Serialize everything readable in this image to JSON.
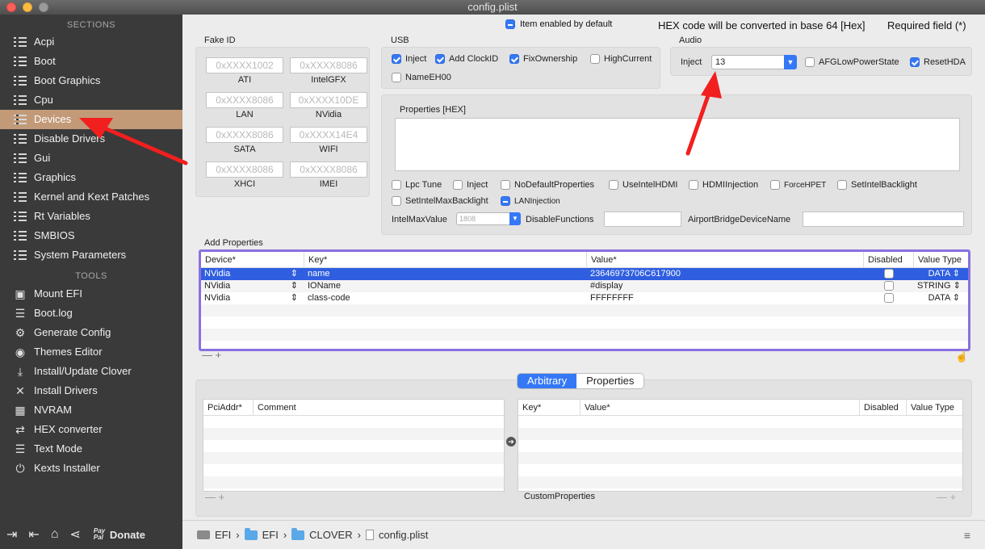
{
  "window": {
    "title": "config.plist"
  },
  "sidebar": {
    "sections_title": "SECTIONS",
    "sections": [
      {
        "label": "Acpi"
      },
      {
        "label": "Boot"
      },
      {
        "label": "Boot Graphics"
      },
      {
        "label": "Cpu"
      },
      {
        "label": "Devices"
      },
      {
        "label": "Disable Drivers"
      },
      {
        "label": "Gui"
      },
      {
        "label": "Graphics"
      },
      {
        "label": "Kernel and Kext Patches"
      },
      {
        "label": "Rt Variables"
      },
      {
        "label": "SMBIOS"
      },
      {
        "label": "System Parameters"
      }
    ],
    "tools_title": "TOOLS",
    "tools": [
      {
        "label": "Mount EFI"
      },
      {
        "label": "Boot.log"
      },
      {
        "label": "Generate Config"
      },
      {
        "label": "Themes Editor"
      },
      {
        "label": "Install/Update Clover"
      },
      {
        "label": "Install Drivers"
      },
      {
        "label": "NVRAM"
      },
      {
        "label": "HEX converter"
      },
      {
        "label": "Text Mode"
      },
      {
        "label": "Kexts Installer"
      }
    ],
    "donate_small": "Pay Pal",
    "donate_label": "Donate"
  },
  "header": {
    "item_enabled": "Item enabled by default",
    "hex_note": "HEX code will be converted in base 64 [Hex]",
    "required": "Required field (*)"
  },
  "fake_id": {
    "title": "Fake ID",
    "fields": [
      {
        "placeholder": "0xXXXX1002",
        "caption": "ATI"
      },
      {
        "placeholder": "0xXXXX8086",
        "caption": "IntelGFX"
      },
      {
        "placeholder": "0xXXXX8086",
        "caption": "LAN"
      },
      {
        "placeholder": "0xXXXX10DE",
        "caption": "NVidia"
      },
      {
        "placeholder": "0xXXXX8086",
        "caption": "SATA"
      },
      {
        "placeholder": "0xXXXX14E4",
        "caption": "WIFI"
      },
      {
        "placeholder": "0xXXXX8086",
        "caption": "XHCI"
      },
      {
        "placeholder": "0xXXXX8086",
        "caption": "IMEI"
      }
    ]
  },
  "usb": {
    "title": "USB",
    "options": [
      {
        "label": "Inject",
        "checked": true
      },
      {
        "label": "Add ClockID",
        "checked": true
      },
      {
        "label": "FixOwnership",
        "checked": true
      },
      {
        "label": "HighCurrent",
        "checked": false
      },
      {
        "label": "NameEH00",
        "checked": false
      }
    ]
  },
  "audio": {
    "title": "Audio",
    "inject_label": "Inject",
    "inject_value": "13",
    "afg_label": "AFGLowPowerState",
    "reset_label": "ResetHDA"
  },
  "properties": {
    "title": "Properties [HEX]",
    "options": [
      {
        "label": "Lpc Tune"
      },
      {
        "label": "Inject"
      },
      {
        "label": "NoDefaultProperties"
      },
      {
        "label": "UseIntelHDMI"
      },
      {
        "label": "HDMIInjection"
      },
      {
        "label": "ForceHPET"
      },
      {
        "label": "SetIntelBacklight"
      },
      {
        "label": "SetIntelMaxBacklight"
      },
      {
        "label": "LANInjection"
      }
    ],
    "intel_max_label": "IntelMaxValue",
    "intel_max_value": "1808",
    "disable_functions_label": "DisableFunctions",
    "airport_label": "AirportBridgeDeviceName"
  },
  "add_properties": {
    "title": "Add Properties",
    "columns": [
      "Device*",
      "Key*",
      "Value*",
      "Disabled",
      "Value Type"
    ],
    "rows": [
      {
        "device": "NVidia",
        "key": "name",
        "value": "23646973706C617900",
        "type": "DATA"
      },
      {
        "device": "NVidia",
        "key": "IOName",
        "value": "#display",
        "type": "STRING"
      },
      {
        "device": "NVidia",
        "key": "class-code",
        "value": "FFFFFFFF",
        "type": "DATA"
      }
    ],
    "minus": "—",
    "plus": "+"
  },
  "custom": {
    "tabs": [
      "Arbitrary",
      "Properties"
    ],
    "left_columns": [
      "PciAddr*",
      "Comment"
    ],
    "right_columns": [
      "Key*",
      "Value*",
      "Disabled",
      "Value Type"
    ],
    "footer_label": "CustomProperties"
  },
  "pathbar": {
    "items": [
      "EFI",
      "EFI",
      "CLOVER",
      "config.plist"
    ],
    "sep": "›"
  }
}
